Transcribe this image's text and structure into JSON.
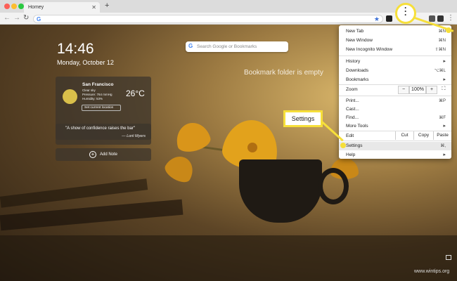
{
  "tabs": [
    {
      "label": "Homey",
      "close": "✕"
    }
  ],
  "new_tab_symbol": "+",
  "toolbar": {
    "back": "←",
    "forward": "→",
    "reload": "↻",
    "google_mark": "G",
    "star": "★",
    "menu_dots": "⋮"
  },
  "momentum": {
    "clock": "14:46",
    "date": "Monday, October 12",
    "search_placeholder": "Search Google or Bookmarks",
    "bookmark_empty": "Bookmark folder is empty",
    "weather": {
      "city": "San Francisco",
      "lines": [
        "Clear sky",
        "Pressure: 764 mmHg",
        "Humidity: 53%"
      ],
      "temperature": "26°C",
      "set_location": "Set current location"
    },
    "quote": {
      "text": "\"A show of confidence raises the bar\"",
      "author": "— Lorii Myers"
    },
    "add_note": "Add Note"
  },
  "menu": {
    "new_tab": "New Tab",
    "new_tab_sc": "⌘N",
    "new_window": "New Window",
    "new_window_sc": "⌘N",
    "new_incognito": "New Incognito Window",
    "new_incognito_sc": "⇧⌘N",
    "history": "History",
    "downloads": "Downloads",
    "downloads_sc": "⌥⌘L",
    "bookmarks": "Bookmarks",
    "zoom": "Zoom",
    "zoom_minus": "−",
    "zoom_value": "100%",
    "zoom_plus": "+",
    "fullscreen": "⛶",
    "print": "Print...",
    "print_sc": "⌘P",
    "cast": "Cast...",
    "find": "Find...",
    "find_sc": "⌘F",
    "more_tools": "More Tools",
    "edit": "Edit",
    "cut": "Cut",
    "copy": "Copy",
    "paste": "Paste",
    "settings": "Settings",
    "settings_sc": "⌘,",
    "help": "Help",
    "arrow": "▸"
  },
  "callout": {
    "settings_label": "Settings"
  },
  "watermark": "www.wintips.org",
  "colors": {
    "callout": "#f6df3a",
    "accent_blue": "#4285f4"
  }
}
